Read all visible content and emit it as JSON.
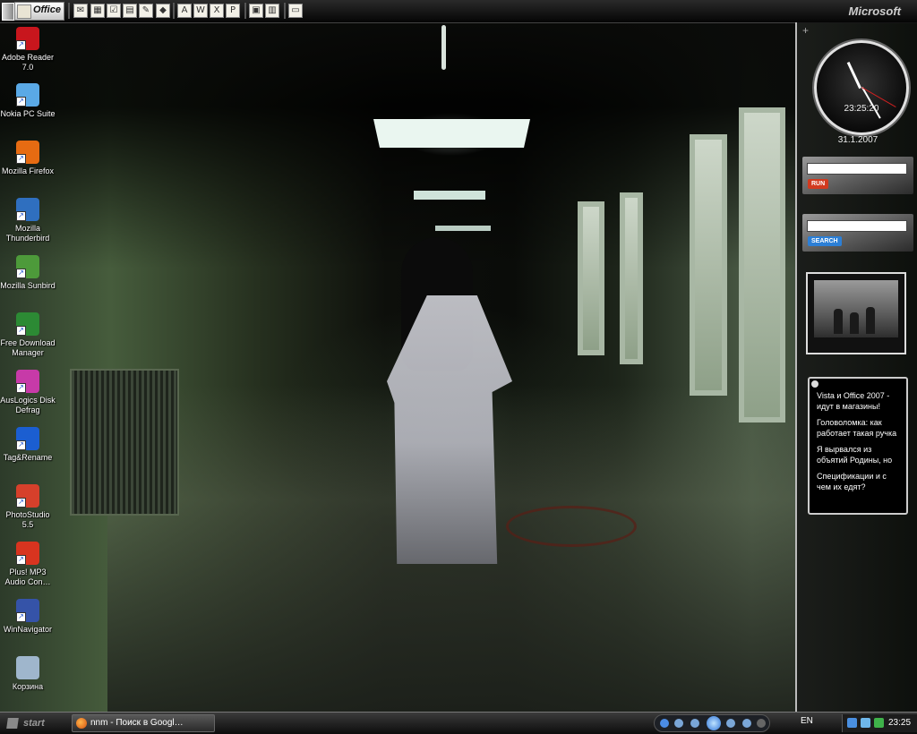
{
  "office_bar": {
    "title": "Office",
    "brand": "Microsoft",
    "buttons": [
      {
        "icon": "mail-icon",
        "glyph": "✉"
      },
      {
        "icon": "calendar-icon",
        "glyph": "▦"
      },
      {
        "icon": "tasks-icon",
        "glyph": "☑"
      },
      {
        "icon": "contact-icon",
        "glyph": "▤"
      },
      {
        "icon": "new-document-icon",
        "glyph": "✎"
      },
      {
        "icon": "note-icon",
        "glyph": "◆"
      },
      {
        "icon": "acrobat-icon",
        "glyph": "A"
      },
      {
        "icon": "word-icon",
        "glyph": "W"
      },
      {
        "icon": "excel-icon",
        "glyph": "X"
      },
      {
        "icon": "publisher-icon",
        "glyph": "P"
      },
      {
        "icon": "explorer-icon",
        "glyph": "▣"
      },
      {
        "icon": "windows-icon",
        "glyph": "▥"
      },
      {
        "icon": "desktop-icon",
        "glyph": "▭"
      }
    ]
  },
  "desktop_icons": [
    {
      "label": "Adobe Reader 7.0",
      "icon": "adobe-reader-icon",
      "color": "#c8161d"
    },
    {
      "label": "Nokia PC Suite",
      "icon": "nokia-pc-suite-icon",
      "color": "#5aa9e6"
    },
    {
      "label": "Mozilla Firefox",
      "icon": "firefox-icon",
      "color": "#e66b12"
    },
    {
      "label": "Mozilla Thunderbird",
      "icon": "thunderbird-icon",
      "color": "#2f6fbf"
    },
    {
      "label": "Mozilla Sunbird",
      "icon": "sunbird-icon",
      "color": "#4d9a3a"
    },
    {
      "label": "Free Download Manager",
      "icon": "download-manager-icon",
      "color": "#2c8a34"
    },
    {
      "label": "AusLogics Disk Defrag",
      "icon": "disk-defrag-icon",
      "color": "#c73aa8"
    },
    {
      "label": "Tag&Rename",
      "icon": "tag-rename-icon",
      "color": "#1b5ed1"
    },
    {
      "label": "PhotoStudio 5.5",
      "icon": "photostudio-icon",
      "color": "#d6402b"
    },
    {
      "label": "Plus! MP3 Audio Con…",
      "icon": "mp3-converter-icon",
      "color": "#d8341f"
    },
    {
      "label": "WinNavigator",
      "icon": "winnavigator-icon",
      "color": "#3553a8"
    },
    {
      "label": "Корзина",
      "icon": "recycle-bin-icon",
      "color": "#9fb6cc"
    }
  ],
  "sidebar": {
    "add_symbol": "+",
    "clock_time": "23:25:20",
    "date": "31.1.2007",
    "run_button": "RUN",
    "search_button": "SEARCH",
    "run_value": "",
    "search_value": "",
    "news": [
      "Vista и Office 2007 - идут в магазины!",
      "Головоломка: как работает такая ручка",
      "Я вырвался из объятий Родины, но",
      "Спецификации и с чем их едят?"
    ]
  },
  "taskbar": {
    "start_label": "start",
    "task_label": "nnm - Поиск в Googl…",
    "language": "EN",
    "time": "23:25"
  }
}
